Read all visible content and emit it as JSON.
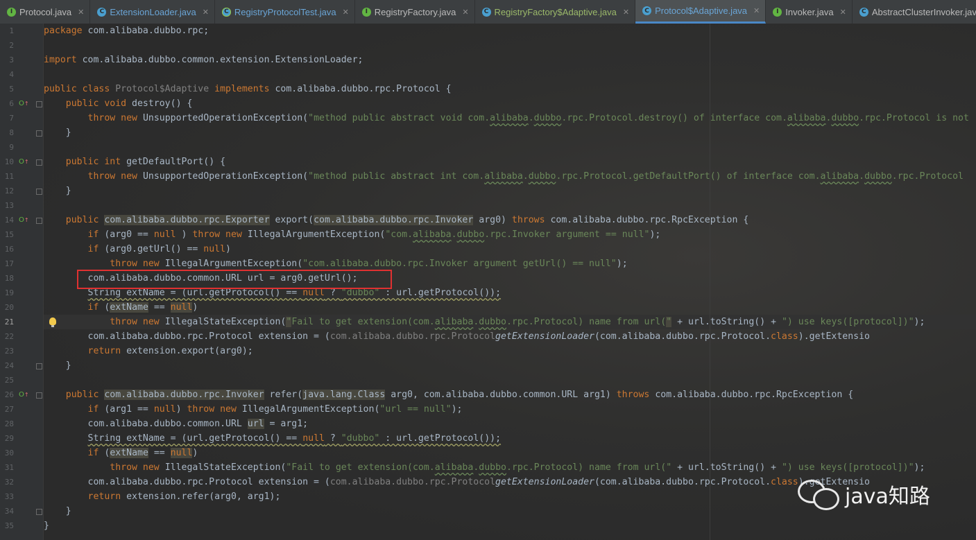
{
  "tabs": [
    {
      "label": "Protocol.java",
      "icon": "interface-icon",
      "style": "normal",
      "active": false
    },
    {
      "label": "ExtensionLoader.java",
      "icon": "class-icon",
      "style": "cyan",
      "active": false
    },
    {
      "label": "RegistryProtocolTest.java",
      "icon": "test-class-icon",
      "style": "cyan",
      "active": false
    },
    {
      "label": "RegistryFactory.java",
      "icon": "interface-icon",
      "style": "normal",
      "active": false
    },
    {
      "label": "RegistryFactory$Adaptive.java",
      "icon": "class-icon",
      "style": "green",
      "active": false
    },
    {
      "label": "Protocol$Adaptive.java",
      "icon": "class-icon",
      "style": "cyan",
      "active": true
    },
    {
      "label": "Invoker.java",
      "icon": "interface-icon",
      "style": "normal",
      "active": false
    },
    {
      "label": "AbstractClusterInvoker.java",
      "icon": "class-icon",
      "style": "normal",
      "active": false
    }
  ],
  "editor": {
    "current_line": 21,
    "line_numbers": [
      "1",
      "2",
      "3",
      "4",
      "5",
      "6",
      "7",
      "8",
      "9",
      "10",
      "11",
      "12",
      "13",
      "14",
      "15",
      "16",
      "17",
      "18",
      "19",
      "20",
      "21",
      "22",
      "23",
      "24",
      "25",
      "26",
      "27",
      "28",
      "29",
      "30",
      "31",
      "32",
      "33",
      "34",
      "35"
    ],
    "lines": [
      [
        [
          "kw",
          "package "
        ],
        [
          "",
          "com.alibaba.dubbo.rpc;"
        ]
      ],
      [],
      [
        [
          "kw",
          "import "
        ],
        [
          "",
          "com.alibaba.dubbo.common.extension.ExtensionLoader;"
        ]
      ],
      [],
      [
        [
          "kw",
          "public class "
        ],
        [
          "gray",
          "Protocol$Adaptive "
        ],
        [
          "kw",
          "implements "
        ],
        [
          "",
          "com.alibaba.dubbo.rpc.Protocol {"
        ]
      ],
      [
        [
          "",
          "    "
        ],
        [
          "kw",
          "public void "
        ],
        [
          "",
          "destroy() {"
        ]
      ],
      [
        [
          "",
          "        "
        ],
        [
          "kw",
          "throw new "
        ],
        [
          "",
          "UnsupportedOperationException("
        ],
        [
          "str",
          "\"method public abstract void com."
        ],
        [
          "str squig",
          "alibaba"
        ],
        [
          "str",
          "."
        ],
        [
          "str squig",
          "dubbo"
        ],
        [
          "str",
          ".rpc.Protocol.destroy() of interface com."
        ],
        [
          "str squig",
          "alibaba"
        ],
        [
          "str",
          "."
        ],
        [
          "str squig",
          "dubbo"
        ],
        [
          "str",
          ".rpc.Protocol is not"
        ]
      ],
      [
        [
          "",
          "    }"
        ]
      ],
      [],
      [
        [
          "",
          "    "
        ],
        [
          "kw",
          "public int "
        ],
        [
          "",
          "getDefaultPort() {"
        ]
      ],
      [
        [
          "",
          "        "
        ],
        [
          "kw",
          "throw new "
        ],
        [
          "",
          "UnsupportedOperationException("
        ],
        [
          "str",
          "\"method public abstract int com."
        ],
        [
          "str squig",
          "alibaba"
        ],
        [
          "str",
          "."
        ],
        [
          "str squig",
          "dubbo"
        ],
        [
          "str",
          ".rpc.Protocol.getDefaultPort() of interface com."
        ],
        [
          "str squig",
          "alibaba"
        ],
        [
          "str",
          "."
        ],
        [
          "str squig",
          "dubbo"
        ],
        [
          "str",
          ".rpc.Protocol"
        ]
      ],
      [
        [
          "",
          "    }"
        ]
      ],
      [],
      [
        [
          "",
          "    "
        ],
        [
          "kw",
          "public "
        ],
        [
          "hl",
          "com.alibaba.dubbo.rpc.Exporter"
        ],
        [
          "",
          " export("
        ],
        [
          "hl",
          "com.alibaba.dubbo.rpc.Invoker"
        ],
        [
          "",
          " arg0) "
        ],
        [
          "kw",
          "throws "
        ],
        [
          "",
          "com.alibaba.dubbo.rpc.RpcException {"
        ]
      ],
      [
        [
          "",
          "        "
        ],
        [
          "kw",
          "if "
        ],
        [
          "",
          "(arg0 == "
        ],
        [
          "kw",
          "null"
        ],
        [
          "",
          " ) "
        ],
        [
          "kw",
          "throw new "
        ],
        [
          "",
          "IllegalArgumentException("
        ],
        [
          "str",
          "\"com."
        ],
        [
          "str squig",
          "alibaba"
        ],
        [
          "str",
          "."
        ],
        [
          "str squig",
          "dubbo"
        ],
        [
          "str",
          ".rpc.Invoker argument == null\""
        ],
        [
          "",
          ");"
        ]
      ],
      [
        [
          "",
          "        "
        ],
        [
          "kw",
          "if "
        ],
        [
          "",
          "(arg0.getUrl() == "
        ],
        [
          "kw",
          "null"
        ],
        [
          "",
          ")"
        ]
      ],
      [
        [
          "",
          "            "
        ],
        [
          "kw",
          "throw new "
        ],
        [
          "",
          "IllegalArgumentException("
        ],
        [
          "str",
          "\"com.alibaba.dubbo.rpc.Invoker argument getUrl() == null\""
        ],
        [
          "",
          ");"
        ]
      ],
      [
        [
          "",
          "        com.alibaba.dubbo.common.URL url = arg0.getUrl();"
        ]
      ],
      [
        [
          "",
          "        "
        ],
        [
          "wq",
          "String extName = (url.getProtocol() == "
        ],
        [
          "kw wq",
          "null"
        ],
        [
          "wq",
          " ? "
        ],
        [
          "str wq",
          "\"dubbo\""
        ],
        [
          "wq",
          " : url.getProtocol());"
        ]
      ],
      [
        [
          "",
          "        "
        ],
        [
          "kw",
          "if "
        ],
        [
          "",
          "("
        ],
        [
          "hl",
          "extName"
        ],
        [
          "",
          " == "
        ],
        [
          "kw hl",
          "null"
        ],
        [
          "",
          ")"
        ]
      ],
      [
        [
          "",
          "            "
        ],
        [
          "kw",
          "throw new "
        ],
        [
          "",
          "IllegalStateException("
        ],
        [
          "str hl",
          "\""
        ],
        [
          "str",
          "Fail to get extension(com."
        ],
        [
          "str squig",
          "alibaba"
        ],
        [
          "str",
          "."
        ],
        [
          "str squig",
          "dubbo"
        ],
        [
          "str",
          ".rpc.Protocol) name from url("
        ],
        [
          "str hl",
          "\""
        ],
        [
          "",
          " + url.toString() + "
        ],
        [
          "str",
          "\") use keys([protocol])\""
        ],
        [
          "",
          ");"
        ]
      ],
      [
        [
          "",
          "        com.alibaba.dubbo.rpc.Protocol extension = ("
        ],
        [
          "gray",
          "com.alibaba.dubbo.rpc.Protocol"
        ],
        [
          ") ExtensionLoader."
        ],
        [
          "it",
          "getExtensionLoader"
        ],
        [
          "",
          "(com.alibaba.dubbo.rpc.Protocol."
        ],
        [
          "kw",
          "class"
        ],
        [
          "",
          ").getExtensio"
        ]
      ],
      [
        [
          "",
          "        "
        ],
        [
          "kw",
          "return "
        ],
        [
          "",
          "extension.export(arg0);"
        ]
      ],
      [
        [
          "",
          "    }"
        ]
      ],
      [],
      [
        [
          "",
          "    "
        ],
        [
          "kw",
          "public "
        ],
        [
          "hl",
          "com.alibaba.dubbo.rpc.Invoker"
        ],
        [
          "",
          " refer("
        ],
        [
          "hl",
          "java.lang.Class"
        ],
        [
          "",
          " arg0, com.alibaba.dubbo.common.URL arg1) "
        ],
        [
          "kw",
          "throws "
        ],
        [
          "",
          "com.alibaba.dubbo.rpc.RpcException {"
        ]
      ],
      [
        [
          "",
          "        "
        ],
        [
          "kw",
          "if "
        ],
        [
          "",
          "(arg1 == "
        ],
        [
          "kw",
          "null"
        ],
        [
          "",
          ") "
        ],
        [
          "kw",
          "throw new "
        ],
        [
          "",
          "IllegalArgumentException("
        ],
        [
          "str",
          "\"url == null\""
        ],
        [
          "",
          ");"
        ]
      ],
      [
        [
          "",
          "        com.alibaba.dubbo.common.URL "
        ],
        [
          "hl",
          "url"
        ],
        [
          "",
          " = arg1;"
        ]
      ],
      [
        [
          "",
          "        "
        ],
        [
          "wq",
          "String extName = (url.getProtocol() == "
        ],
        [
          "kw wq",
          "null"
        ],
        [
          "wq",
          " ? "
        ],
        [
          "str wq",
          "\"dubbo\""
        ],
        [
          "wq",
          " : url.getProtocol());"
        ]
      ],
      [
        [
          "",
          "        "
        ],
        [
          "kw",
          "if "
        ],
        [
          "",
          "("
        ],
        [
          "hl",
          "extName"
        ],
        [
          "",
          " == "
        ],
        [
          "kw hl",
          "null"
        ],
        [
          "",
          ")"
        ]
      ],
      [
        [
          "",
          "            "
        ],
        [
          "kw",
          "throw new "
        ],
        [
          "",
          "IllegalStateException("
        ],
        [
          "str",
          "\"Fail to get extension(com."
        ],
        [
          "str squig",
          "alibaba"
        ],
        [
          "str",
          "."
        ],
        [
          "str squig",
          "dubbo"
        ],
        [
          "str",
          ".rpc.Protocol) name from url(\""
        ],
        [
          "",
          " + url.toString() + "
        ],
        [
          "str",
          "\") use keys([protocol])\""
        ],
        [
          "",
          ");"
        ]
      ],
      [
        [
          "",
          "        com.alibaba.dubbo.rpc.Protocol extension = ("
        ],
        [
          "gray",
          "com.alibaba.dubbo.rpc.Protocol"
        ],
        [
          ") ExtensionLoader."
        ],
        [
          "it",
          "getExtensionLoader"
        ],
        [
          "",
          "(com.alibaba.dubbo.rpc.Protocol."
        ],
        [
          "kw",
          "class"
        ],
        [
          "",
          ").getExtensio"
        ]
      ],
      [
        [
          "",
          "        "
        ],
        [
          "kw",
          "return "
        ],
        [
          "",
          "extension.refer(arg0, arg1);"
        ]
      ],
      [
        [
          "",
          "    }"
        ]
      ],
      [
        [
          "",
          "}"
        ]
      ]
    ],
    "override_markers": [
      6,
      10,
      14,
      26
    ],
    "fold_markers": [
      6,
      8,
      10,
      12,
      14,
      24,
      26,
      34
    ]
  },
  "watermark": {
    "text": "java知路",
    "icon": "wechat-logo-icon"
  },
  "colors": {
    "keyword": "#cc7832",
    "string": "#6a8759",
    "text": "#a9b7c6",
    "highlight_box": "#e03131",
    "active_tab_underline": "#4a88c7"
  }
}
